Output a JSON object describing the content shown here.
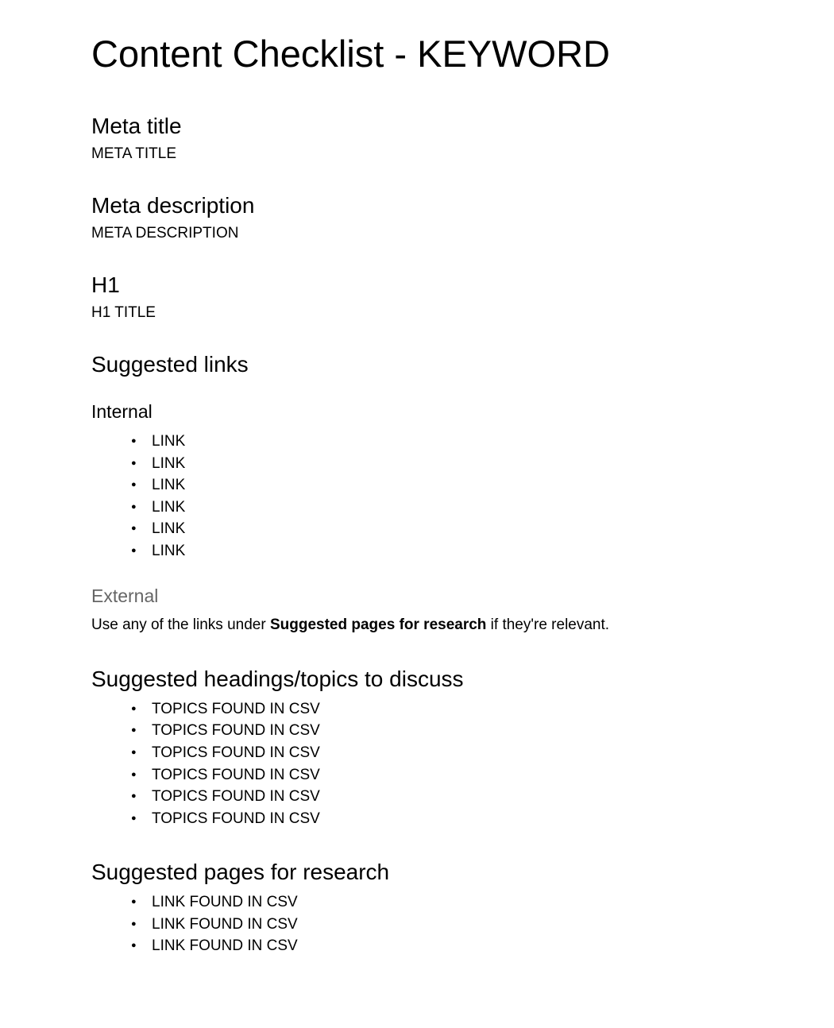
{
  "title": "Content Checklist - KEYWORD",
  "sections": {
    "meta_title": {
      "heading": "Meta title",
      "value": "META TITLE"
    },
    "meta_description": {
      "heading": "Meta description",
      "value": "META DESCRIPTION"
    },
    "h1": {
      "heading": "H1",
      "value": "H1 TITLE"
    },
    "suggested_links": {
      "heading": "Suggested links",
      "internal": {
        "heading": "Internal",
        "items": [
          "LINK",
          "LINK",
          "LINK",
          "LINK",
          "LINK",
          "LINK"
        ]
      },
      "external": {
        "heading": "External",
        "text_prefix": "Use any of the links under ",
        "text_bold": "Suggested pages for research",
        "text_suffix": " if they're relevant."
      }
    },
    "suggested_topics": {
      "heading": "Suggested headings/topics to discuss",
      "items": [
        "TOPICS FOUND IN CSV",
        "TOPICS FOUND IN CSV",
        "TOPICS FOUND IN CSV",
        "TOPICS FOUND IN CSV",
        "TOPICS FOUND IN CSV",
        "TOPICS FOUND IN CSV"
      ]
    },
    "suggested_pages": {
      "heading": "Suggested pages for research",
      "items": [
        "LINK FOUND IN CSV",
        "LINK FOUND IN CSV",
        "LINK FOUND IN CSV"
      ]
    }
  }
}
